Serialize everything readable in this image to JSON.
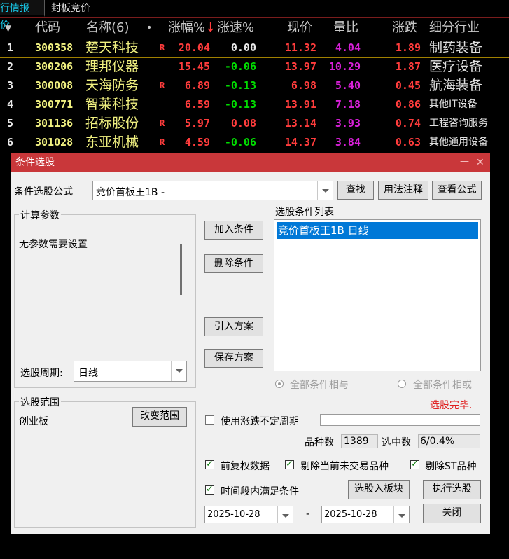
{
  "tabs": [
    {
      "label": "行情报价",
      "active": true
    },
    {
      "label": "封板竞价",
      "active": false
    }
  ],
  "table": {
    "columns": {
      "menu": "▼",
      "code": "代码",
      "name": "名称(6)",
      "dot": "•",
      "change_pct": "涨幅%",
      "sort_arrow": "↓",
      "speed_pct": "涨速%",
      "price": "现价",
      "volume_ratio": "量比",
      "change": "涨跌",
      "industry": "细分行业"
    },
    "rows": [
      {
        "idx": "1",
        "code": "300358",
        "name": "楚天科技",
        "flag": "R",
        "change_pct": "20.04",
        "speed_pct": "0.00",
        "price": "11.32",
        "volume_ratio": "4.04",
        "change": "1.89",
        "industry": "制药装备"
      },
      {
        "idx": "2",
        "code": "300206",
        "name": "理邦仪器",
        "flag": "",
        "change_pct": "15.45",
        "speed_pct": "-0.06",
        "price": "13.97",
        "volume_ratio": "10.29",
        "change": "1.87",
        "industry": "医疗设备"
      },
      {
        "idx": "3",
        "code": "300008",
        "name": "天海防务",
        "flag": "R",
        "change_pct": "6.89",
        "speed_pct": "-0.13",
        "price": "6.98",
        "volume_ratio": "5.40",
        "change": "0.45",
        "industry": "航海装备"
      },
      {
        "idx": "4",
        "code": "300771",
        "name": "智莱科技",
        "flag": "",
        "change_pct": "6.59",
        "speed_pct": "-0.13",
        "price": "13.91",
        "volume_ratio": "7.18",
        "change": "0.86",
        "industry": "其他IT设备"
      },
      {
        "idx": "5",
        "code": "301136",
        "name": "招标股份",
        "flag": "R",
        "change_pct": "5.97",
        "speed_pct": "0.08",
        "price": "13.14",
        "volume_ratio": "3.93",
        "change": "0.74",
        "industry": "工程咨询服务"
      },
      {
        "idx": "6",
        "code": "301028",
        "name": "东亚机械",
        "flag": "R",
        "change_pct": "4.59",
        "speed_pct": "-0.06",
        "price": "14.37",
        "volume_ratio": "3.84",
        "change": "0.63",
        "industry": "其他通用设备"
      }
    ]
  },
  "colors": {
    "header_text": "#c8c8c8",
    "code": "#f0f080",
    "name": "#f0f080",
    "up": "#ff3c3c",
    "down": "#00dc00",
    "flat": "#e8e8e8",
    "volume_ratio": "#d820d8",
    "industry": "#e0e0e0",
    "dialog_title_bg": "#c9373a",
    "selection_bg": "#0078d7",
    "status_done": "#e02020"
  },
  "dialog": {
    "title": "条件选股",
    "minimize_icon": "—",
    "close_icon": "✕",
    "formula_label": "条件选股公式",
    "formula_value": "竞价首板王1B  -",
    "find_button": "查找",
    "usage_button": "用法注释",
    "view_formula_button": "查看公式",
    "params_group_label": "计算参数",
    "params_text": "无参数需要设置",
    "period_label": "选股周期:",
    "period_value": "日线",
    "add_condition_button": "加入条件",
    "delete_condition_button": "删除条件",
    "import_plan_button": "引入方案",
    "save_plan_button": "保存方案",
    "conditions_list_label": "选股条件列表",
    "conditions": [
      "竞价首板王1B  日线"
    ],
    "radio_and_label": "全部条件相与",
    "radio_or_label": "全部条件相或",
    "status_text": "选股完毕.",
    "range_group_label": "选股范围",
    "range_value": "创业板",
    "change_range_button": "改变范围",
    "use_variable_period_label": "使用涨跌不定周期",
    "variable_period_value": "",
    "count_label": "品种数",
    "count_value": "1389",
    "selected_label": "选中数",
    "selected_value": "6/0.4%",
    "adjusted_label": "前复权数据",
    "exclude_untraded_label": "剔除当前未交易品种",
    "exclude_st_label": "剔除ST品种",
    "time_range_label": "时间段内满足条件",
    "to_block_button": "选股入板块",
    "execute_button": "执行选股",
    "start_date": "2025-10-28",
    "date_separator": "-",
    "end_date": "2025-10-28",
    "close_button": "关闭"
  }
}
